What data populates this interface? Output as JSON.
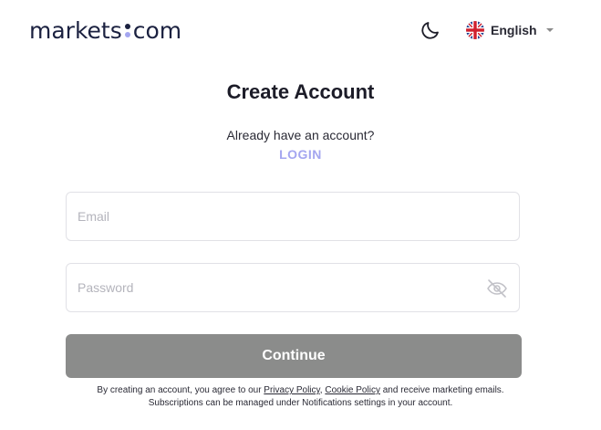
{
  "header": {
    "logo_left": "markets",
    "logo_right": "com",
    "theme_icon": "moon-icon",
    "language": {
      "flag_icon": "uk-flag-icon",
      "label": "English"
    }
  },
  "form": {
    "title": "Create Account",
    "already_text": "Already have an account?",
    "login_label": "LOGIN",
    "email": {
      "placeholder": "Email",
      "value": ""
    },
    "password": {
      "placeholder": "Password",
      "value": "",
      "visibility_icon": "eye-off-icon"
    },
    "continue_label": "Continue"
  },
  "terms": {
    "line1_prefix": "By creating an account, you agree to our ",
    "privacy_link": "Privacy Policy",
    "separator": ", ",
    "cookie_link": "Cookie Policy",
    "line1_suffix": " and receive marketing emails.",
    "line2": "Subscriptions can be managed under Notifications settings in your account."
  },
  "colors": {
    "brand_navy": "#1b2140",
    "accent_lavender": "#a4a6f0",
    "button_disabled": "#8b8c8b"
  }
}
